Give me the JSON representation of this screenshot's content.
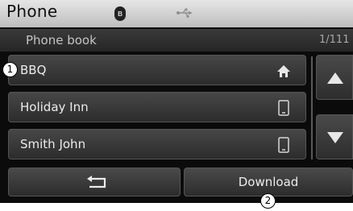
{
  "header": {
    "title": "Phone",
    "bluetooth_icon": "bluetooth-icon",
    "usb_icon": "usb-icon"
  },
  "list_header": {
    "title": "Phone book",
    "page_indicator": "1/111"
  },
  "contacts": [
    {
      "name": "BBQ",
      "icon": "home-icon"
    },
    {
      "name": "Holiday Inn",
      "icon": "mobile-phone-icon"
    },
    {
      "name": "Smith John",
      "icon": "mobile-phone-icon"
    }
  ],
  "scroll": {
    "up_icon": "arrow-up-icon",
    "down_icon": "arrow-down-icon"
  },
  "footer": {
    "back_icon": "back-arrow-icon",
    "download_label": "Download"
  },
  "callouts": {
    "first": "1",
    "second": "2"
  }
}
